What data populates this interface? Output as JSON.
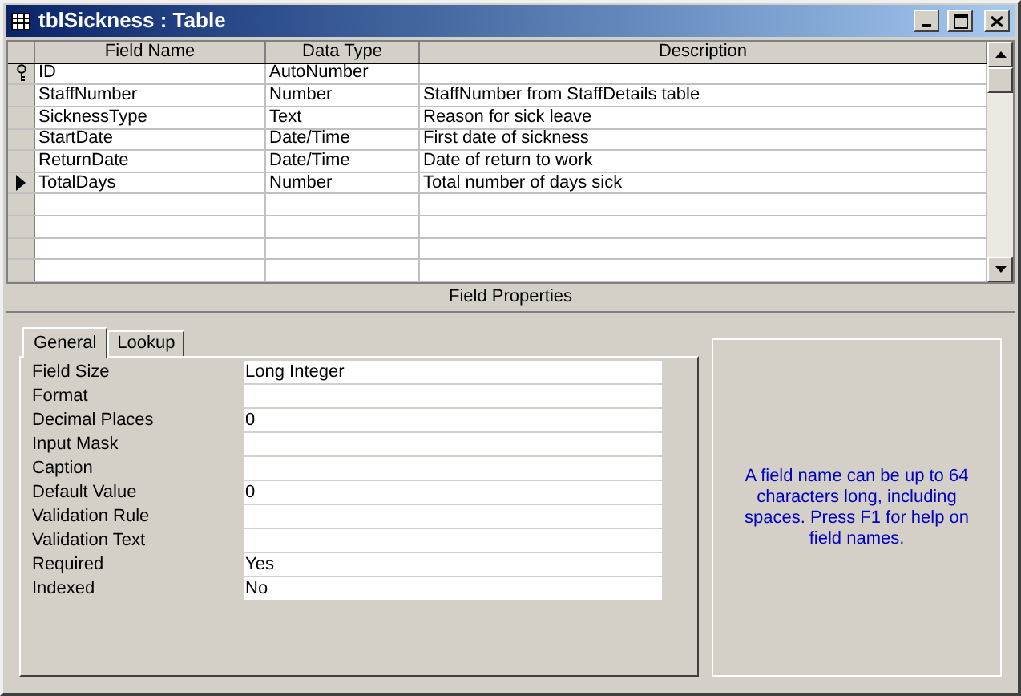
{
  "window": {
    "title": "tblSickness : Table"
  },
  "table": {
    "columns": [
      "Field Name",
      "Data Type",
      "Description"
    ],
    "rows": [
      {
        "primary_key": true,
        "current": false,
        "cells": [
          "ID",
          "AutoNumber",
          ""
        ]
      },
      {
        "primary_key": false,
        "current": false,
        "cells": [
          "StaffNumber",
          "Number",
          "StaffNumber from StaffDetails table"
        ]
      },
      {
        "primary_key": false,
        "current": false,
        "cells": [
          "SicknessType",
          "Text",
          "Reason for sick leave"
        ]
      },
      {
        "primary_key": false,
        "current": false,
        "cells": [
          "StartDate",
          "Date/Time",
          "First date of sickness"
        ]
      },
      {
        "primary_key": false,
        "current": false,
        "cells": [
          "ReturnDate",
          "Date/Time",
          "Date of return to work"
        ]
      },
      {
        "primary_key": false,
        "current": true,
        "cells": [
          "TotalDays",
          "Number",
          "Total number of days sick"
        ]
      }
    ]
  },
  "field_properties": {
    "title": "Field Properties",
    "tabs": [
      {
        "label": "General",
        "selected": true
      },
      {
        "label": "Lookup",
        "selected": false
      }
    ],
    "properties": [
      {
        "label": "Field Size",
        "value": "Long Integer"
      },
      {
        "label": "Format"
      },
      {
        "label": "Decimal Places",
        "value": "0"
      },
      {
        "label": "Input Mask"
      },
      {
        "label": "Caption"
      },
      {
        "label": "Default Value",
        "value": "0"
      },
      {
        "label": "Validation Rule"
      },
      {
        "label": "Validation Text"
      },
      {
        "label": "Required",
        "value": "Yes"
      },
      {
        "label": "Indexed",
        "value": "No"
      }
    ],
    "help": "A field name can be up to 64 characters long, including spaces.  Press F1 for help on field names."
  }
}
